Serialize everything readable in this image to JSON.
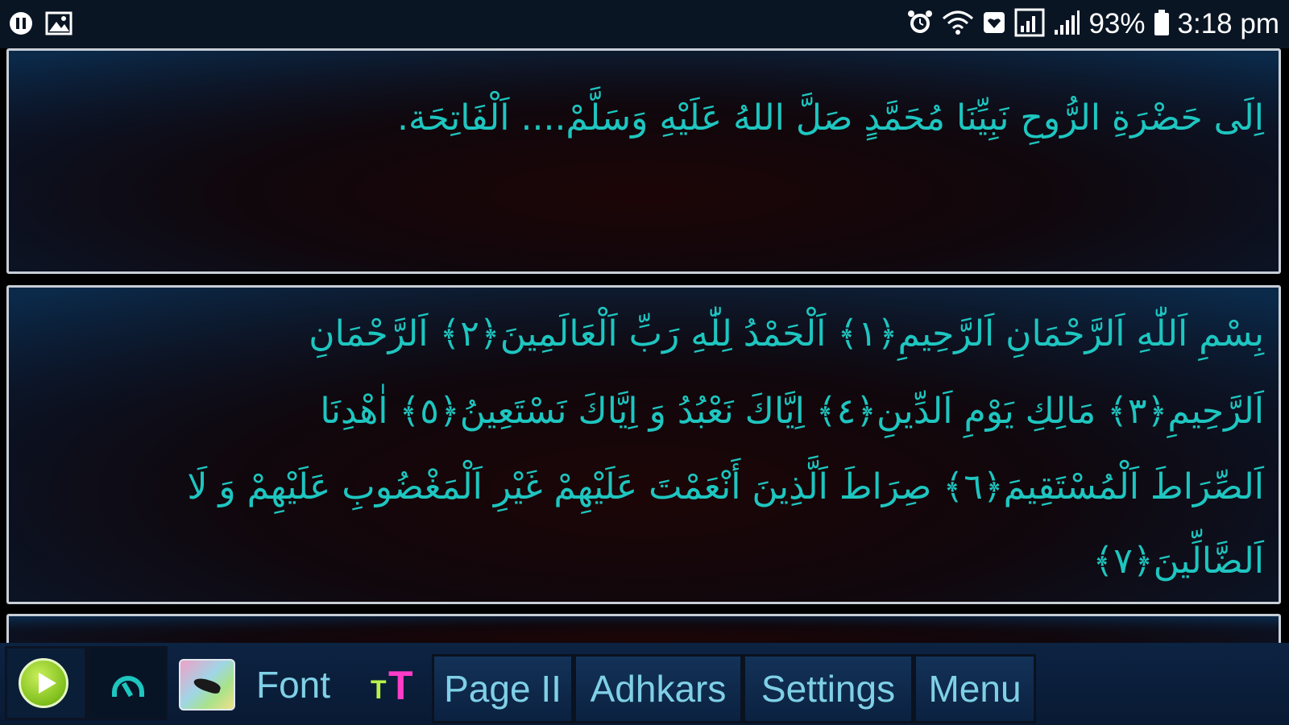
{
  "status_bar": {
    "battery_percent": "93%",
    "time": "3:18 pm",
    "left_icons": [
      "pause-icon",
      "image-icon"
    ],
    "right_icons": [
      "alarm-icon",
      "wifi-icon",
      "shield-icon",
      "signal-box-icon",
      "signal-bars-icon",
      "battery-icon"
    ]
  },
  "panels": {
    "dua": "اِلَى حَضْرَةِ الرُّوحِ نَبِيِّنَا مُحَمَّدٍ صَلَّ اللهُ عَلَيْهِ وَسَلَّمْ.... اَلْفَاتِحَة.",
    "fatiha_lines": [
      "بِسْمِ اَللّٰهِ اَلرَّحْمَانِ اَلرَّحِيمِ﴿١﴾ اَلْحَمْدُ لِلّٰهِ رَبِّ اَلْعَالَمِينَ﴿٢﴾ اَلرَّحْمَانِ",
      "اَلرَّحِيمِ﴿٣﴾ مَالِكِ يَوْمِ اَلدِّينِ﴿٤﴾ اِيَّاكَ نَعْبُدُ وَ اِيَّاكَ نَسْتَعِينُ﴿٥﴾ اٰهْدِنَا",
      "اَلصِّرَاطَ اَلْمُسْتَقِيمَ﴿٦﴾ صِرَاطَ اَلَّذِينَ أَنْعَمْتَ عَلَيْهِمْ غَيْرِ اَلْمَغْضُوبِ عَلَيْهِمْ وَ لَا",
      "اَلضَّالِّينَ﴿٧﴾"
    ]
  },
  "toolbar": {
    "font_label": "Font",
    "page_label": "Page II",
    "adhkar_label": "Adhkars",
    "settings_label": "Settings",
    "menu_label": "Menu"
  },
  "colors": {
    "arabic_text": "#1ec6c0",
    "toolbar_text": "#7fd0e6",
    "panel_border": "#c8ced6"
  }
}
